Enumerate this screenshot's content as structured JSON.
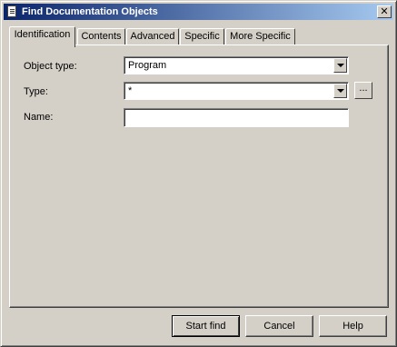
{
  "window": {
    "title": "Find Documentation Objects",
    "close_glyph": "✕"
  },
  "tabs": [
    {
      "label": "Identification",
      "active": true
    },
    {
      "label": "Contents",
      "active": false
    },
    {
      "label": "Advanced",
      "active": false
    },
    {
      "label": "Specific",
      "active": false
    },
    {
      "label": "More Specific",
      "active": false
    }
  ],
  "form": {
    "object_type": {
      "label": "Object type:",
      "value": "Program"
    },
    "type": {
      "label": "Type:",
      "value": "*",
      "browse_label": "..."
    },
    "name": {
      "label": "Name:",
      "value": ""
    }
  },
  "buttons": {
    "start_find": "Start find",
    "cancel": "Cancel",
    "help": "Help"
  },
  "icons": {
    "window": "document-icon",
    "close": "close-icon",
    "dropdown": "chevron-down-icon"
  }
}
